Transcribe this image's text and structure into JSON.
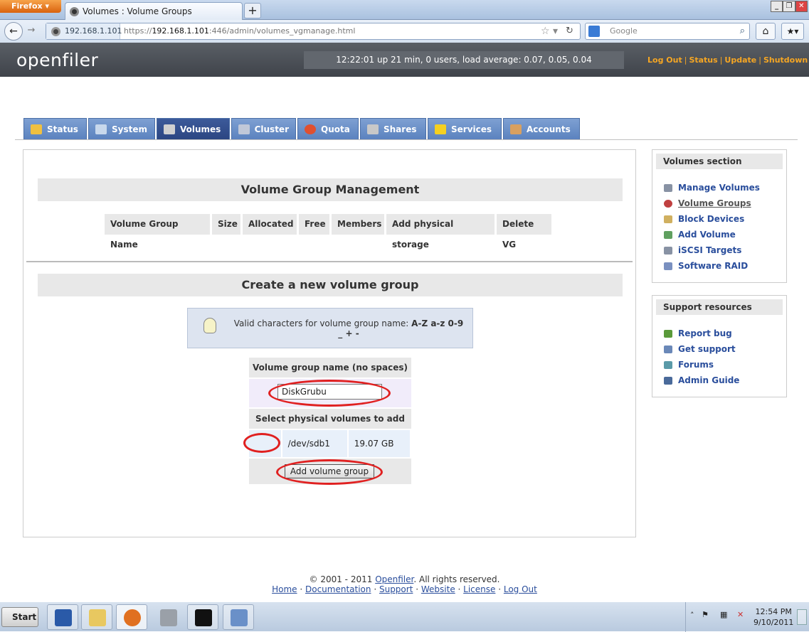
{
  "browser": {
    "menu_button": "Firefox",
    "tab_title": "Volumes : Volume Groups",
    "new_tab": "+",
    "site_identity": "192.168.1.101",
    "url_prefix": "https://",
    "url_host": "192.168.1.101",
    "url_rest": ":446/admin/volumes_vgmanage.html",
    "search_placeholder": "Google",
    "window_controls": [
      "_",
      "❐",
      "✕"
    ]
  },
  "header": {
    "logo": "openfiler",
    "uptime": "12:22:01 up 21 min, 0 users, load average: 0.07, 0.05, 0.04",
    "links": [
      "Log Out",
      "Status",
      "Update",
      "Shutdown"
    ]
  },
  "tabs": [
    {
      "label": "Status",
      "icon": "sun-icon",
      "color": "#f0c040"
    },
    {
      "label": "System",
      "icon": "monitor-icon",
      "color": "#c8d8ec"
    },
    {
      "label": "Volumes",
      "icon": "disk-icon",
      "color": "#d0d0d0"
    },
    {
      "label": "Cluster",
      "icon": "cluster-icon",
      "color": "#c0c8d8"
    },
    {
      "label": "Quota",
      "icon": "pie-chart-icon",
      "color": "#e05030"
    },
    {
      "label": "Shares",
      "icon": "server-icon",
      "color": "#c8c8c8"
    },
    {
      "label": "Services",
      "icon": "lightning-icon",
      "color": "#f5d020"
    },
    {
      "label": "Accounts",
      "icon": "users-icon",
      "color": "#d8a060"
    }
  ],
  "active_tab": "Volumes",
  "main": {
    "vg_management_title": "Volume Group Management",
    "vg_table_headers": [
      "Volume Group Name",
      "Size",
      "Allocated",
      "Free",
      "Members",
      "Add physical storage",
      "Delete VG"
    ],
    "create_title": "Create a new volume group",
    "hint_text": "Valid characters for volume group name:",
    "hint_chars": "A-Z a-z 0-9 _ + -",
    "name_header": "Volume group name (no spaces)",
    "name_value": "DiskGrubu",
    "pv_header": "Select physical volumes to add",
    "pv_rows": [
      {
        "device": "/dev/sdb1",
        "size": "19.07 GB",
        "checked": true
      }
    ],
    "submit_label": "Add volume group"
  },
  "sidebar_volumes": {
    "title": "Volumes section",
    "items": [
      "Manage Volumes",
      "Volume Groups",
      "Block Devices",
      "Add Volume",
      "iSCSI Targets",
      "Software RAID"
    ],
    "current": "Volume Groups"
  },
  "sidebar_support": {
    "title": "Support resources",
    "items": [
      "Report bug",
      "Get support",
      "Forums",
      "Admin Guide"
    ]
  },
  "footer": {
    "copyright": "© 2001 - 2011",
    "brand_link": "Openfiler",
    "rights": ". All rights reserved.",
    "links": [
      "Home",
      "Documentation",
      "Support",
      "Website",
      "License",
      "Log Out"
    ]
  },
  "taskbar": {
    "start": "Start",
    "time": "12:54 PM",
    "date": "9/10/2011"
  },
  "colors": {
    "accent": "#f5a623",
    "tab_active": "#2c4682",
    "link": "#2a4e9c",
    "highlight_ring": "#e02020"
  }
}
